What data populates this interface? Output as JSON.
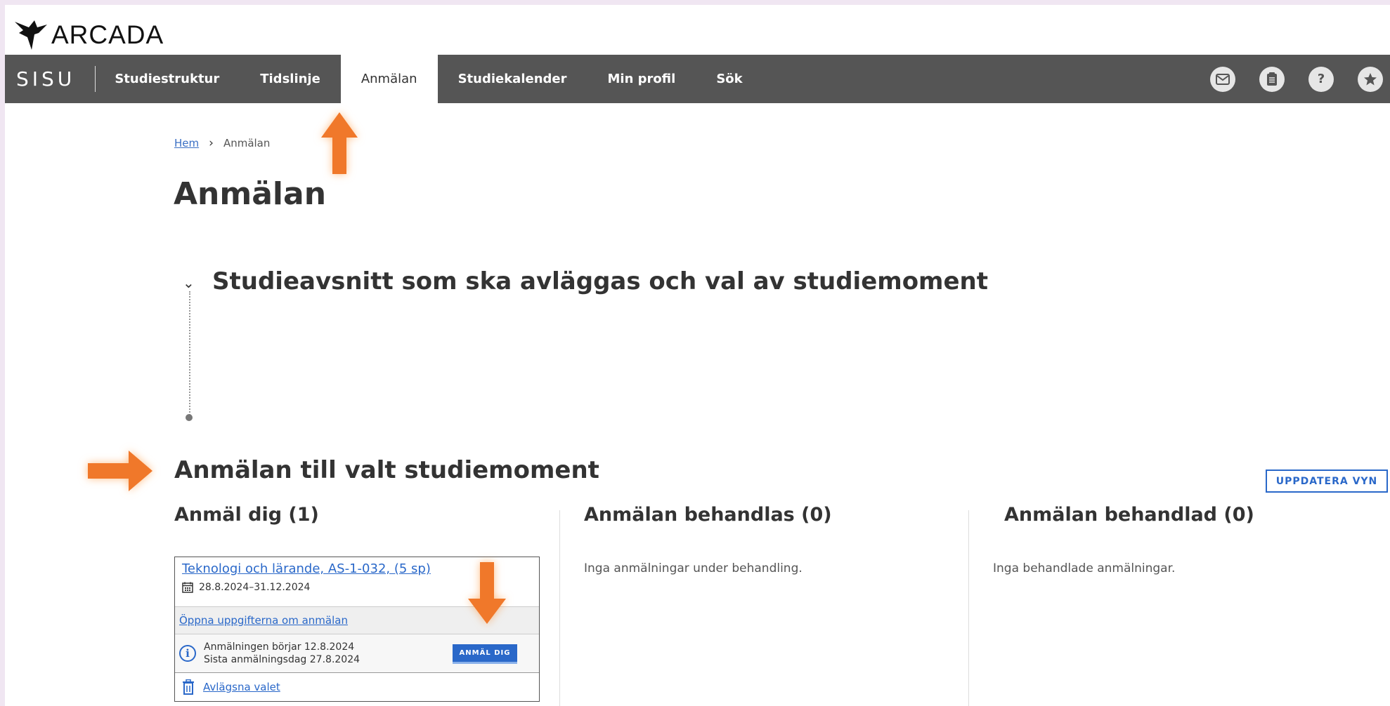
{
  "brand": {
    "logo_text": "ARCADA",
    "app_name": "SISU"
  },
  "nav": {
    "items": [
      {
        "label": "Studiestruktur"
      },
      {
        "label": "Tidslinje"
      },
      {
        "label": "Anmälan",
        "active": true
      },
      {
        "label": "Studiekalender"
      },
      {
        "label": "Min profil"
      },
      {
        "label": "Sök"
      }
    ],
    "icons": [
      "mail-icon",
      "notes-icon",
      "help-icon",
      "favorites-icon"
    ],
    "help_glyph": "?"
  },
  "breadcrumb": {
    "home": "Hem",
    "current": "Anmälan"
  },
  "page": {
    "title": "Anmälan",
    "section_heading": "Studieavsnitt som ska avläggas och val av studiemoment",
    "enroll_heading": "Anmälan till valt studiemoment",
    "update_button": "UPPDATERA VYN"
  },
  "columns": {
    "register": {
      "title": "Anmäl dig (1)"
    },
    "processing": {
      "title": "Anmälan behandlas (0)",
      "empty": "Inga anmälningar under behandling."
    },
    "processed": {
      "title": "Anmälan behandlad (0)",
      "empty": "Inga behandlade anmälningar."
    }
  },
  "card": {
    "course": "Teknologi och lärande, AS-1-032, (5 sp)",
    "dates": "28.8.2024–31.12.2024",
    "details_link": "Öppna uppgifterna om anmälan",
    "info_line1": "Anmälningen börjar 12.8.2024",
    "info_line2": "Sista anmälningsdag 27.8.2024",
    "enroll_button": "ANMÄL DIG",
    "remove_link": "Avlägsna valet"
  },
  "colors": {
    "navbar": "#555555",
    "accent": "#2a68c9",
    "callout_arrow": "#f0782a",
    "page_border": "#f0e6f2"
  }
}
